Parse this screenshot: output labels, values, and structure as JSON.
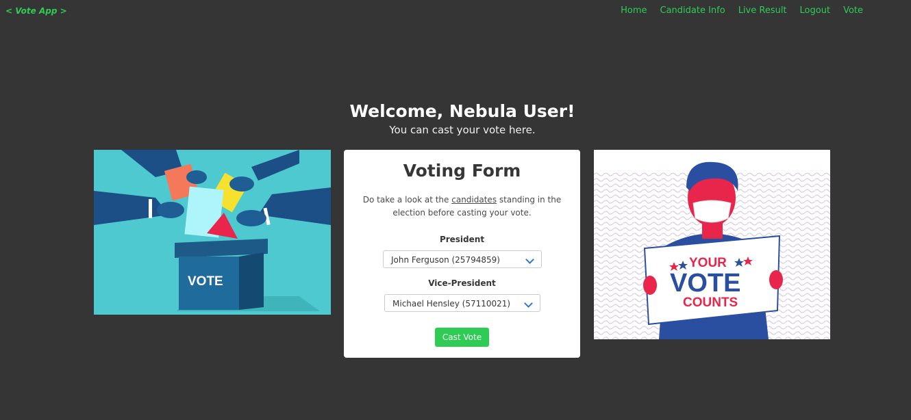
{
  "brand": {
    "label": "< Vote App >"
  },
  "nav": {
    "items": [
      "Home",
      "Candidate Info",
      "Live Result",
      "Logout",
      "Vote"
    ]
  },
  "welcome": {
    "title": "Welcome, Nebula User!",
    "subtitle": "You can cast your vote here."
  },
  "form": {
    "title": "Voting Form",
    "intro_before": "Do take a look at the ",
    "intro_link": "candidates",
    "intro_after": " standing in the election before casting your vote.",
    "president_label": "President",
    "president_value": "John Ferguson (25794859)",
    "vice_label": "Vice-President",
    "vice_value": "Michael Hensley (57110021)",
    "submit_label": "Cast Vote"
  },
  "illustrations": {
    "left_box_text": "VOTE",
    "right_sign_line1": "YOUR",
    "right_sign_line2": "VOTE",
    "right_sign_line3": "COUNTS"
  },
  "colors": {
    "background": "#353535",
    "accent": "#2ecc55",
    "link_select": "#3273dc",
    "left_illus_bg": "#4ec9cf",
    "sign_red": "#e8254a",
    "sign_blue": "#2a4fa0"
  }
}
